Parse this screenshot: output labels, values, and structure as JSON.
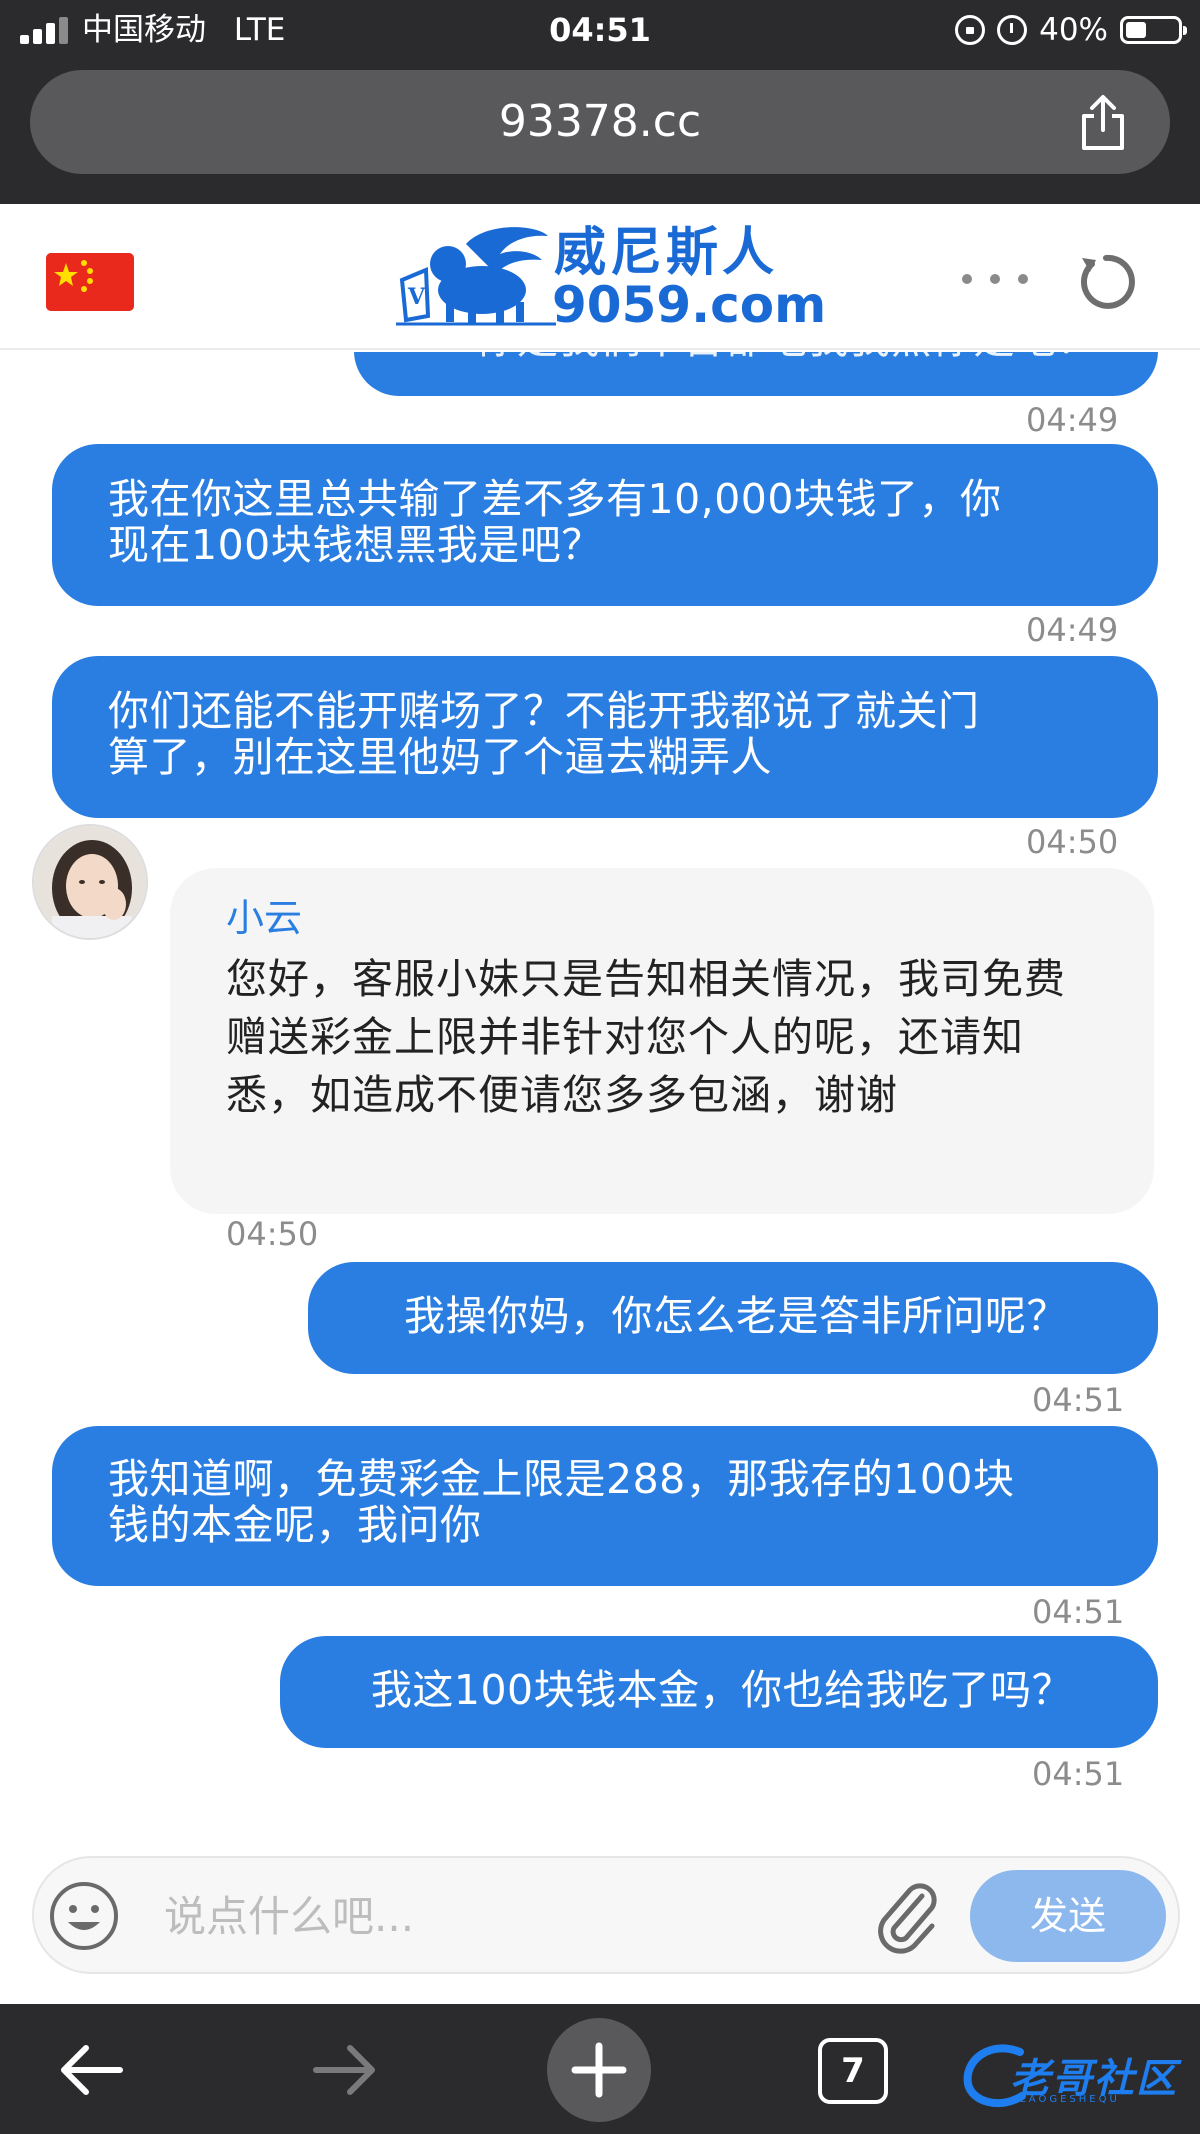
{
  "status_bar": {
    "carrier": "中国移动",
    "network": "LTE",
    "time": "04:51",
    "battery": "40%",
    "battery_level": 0.4
  },
  "browser": {
    "url": "93378.cc",
    "tab_count": "7"
  },
  "site": {
    "logo_line1": "威尼斯人",
    "logo_line2": "9059.com"
  },
  "chat": {
    "partial_message": "你是我们平台都吃我我黑你是吧？",
    "messages": [
      {
        "role": "user",
        "lines": [
          "我在你这里总共输了差不多有10,000块钱了，你",
          "现在100块钱想黑我是吧？"
        ],
        "time": "04:49"
      },
      {
        "role": "user",
        "lines": [
          "你们还能不能开赌场了？不能开我都说了就关门",
          "算了，别在这里他妈了个逼去糊弄人"
        ],
        "time": "04:50"
      },
      {
        "role": "agent",
        "name": "小云",
        "text": "您好，客服小妹只是告知相关情况，我司免费赠送彩金上限并非针对您个人的呢，还请知悉，如造成不便请您多多包涵，谢谢",
        "time": "04:50"
      },
      {
        "role": "user",
        "lines": [
          "我操你妈，你怎么老是答非所问呢？"
        ],
        "time": "04:51"
      },
      {
        "role": "user",
        "lines": [
          "我知道啊，免费彩金上限是288，那我存的100块",
          "钱的本金呢，我问你"
        ],
        "time": "04:51"
      },
      {
        "role": "user",
        "lines": [
          "我这100块钱本金，你也给我吃了吗？"
        ],
        "time": "04:51"
      }
    ],
    "first_time": "04:49"
  },
  "composer": {
    "placeholder": "说点什么吧...",
    "send_label": "发送"
  },
  "watermark": {
    "text": "老哥社区",
    "sub": "LAOGESHEQU"
  },
  "colors": {
    "user_bubble": "#2a7de1",
    "agent_bubble": "#f5f5f5",
    "send_button": "#8db8ee",
    "chrome": "#2b2b2d"
  }
}
